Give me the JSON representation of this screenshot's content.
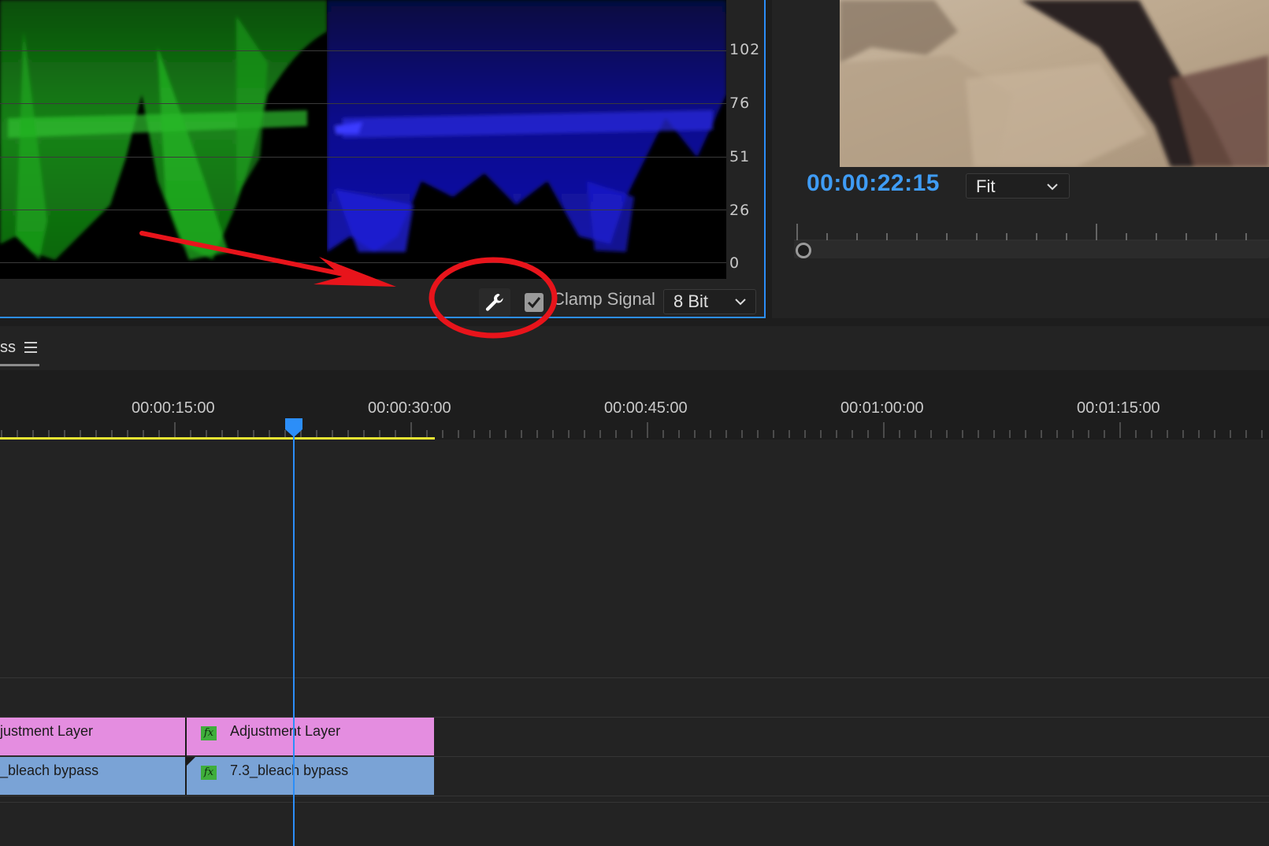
{
  "scope": {
    "axis_labels": [
      "102",
      "76",
      "51",
      "26",
      "0"
    ],
    "clamp_signal_label": "Clamp Signal",
    "clamp_signal_checked": true,
    "bit_depth_value": "8 Bit"
  },
  "program_monitor": {
    "timecode": "00:00:22:15",
    "zoom_value": "Fit"
  },
  "timeline": {
    "sequence_tab_label": "ss",
    "ruler_labels": [
      "00:00:15:00",
      "00:00:30:00",
      "00:00:45:00",
      "00:01:00:00",
      "00:01:15:00"
    ],
    "clips": [
      {
        "label": "justment Layer",
        "has_fx": false
      },
      {
        "label": "Adjustment Layer",
        "has_fx": true
      },
      {
        "label": "_bleach bypass",
        "has_fx": false
      },
      {
        "label": "7.3_bleach bypass",
        "has_fx": true
      }
    ],
    "fx_badge_text": "fx"
  },
  "colors": {
    "accent_blue": "#2c8ef8",
    "timecode_blue": "#3f9cf5",
    "work_area_yellow": "#e6e332",
    "adjustment_clip_pink": "#e48de0",
    "video_clip_blue": "#7aa3d6",
    "annotation_red": "#e8141b"
  },
  "icons": [
    "wrench-icon",
    "checkmark-icon",
    "chevron-down-icon",
    "hamburger-menu-icon",
    "playhead-icon",
    "fx-icon"
  ]
}
